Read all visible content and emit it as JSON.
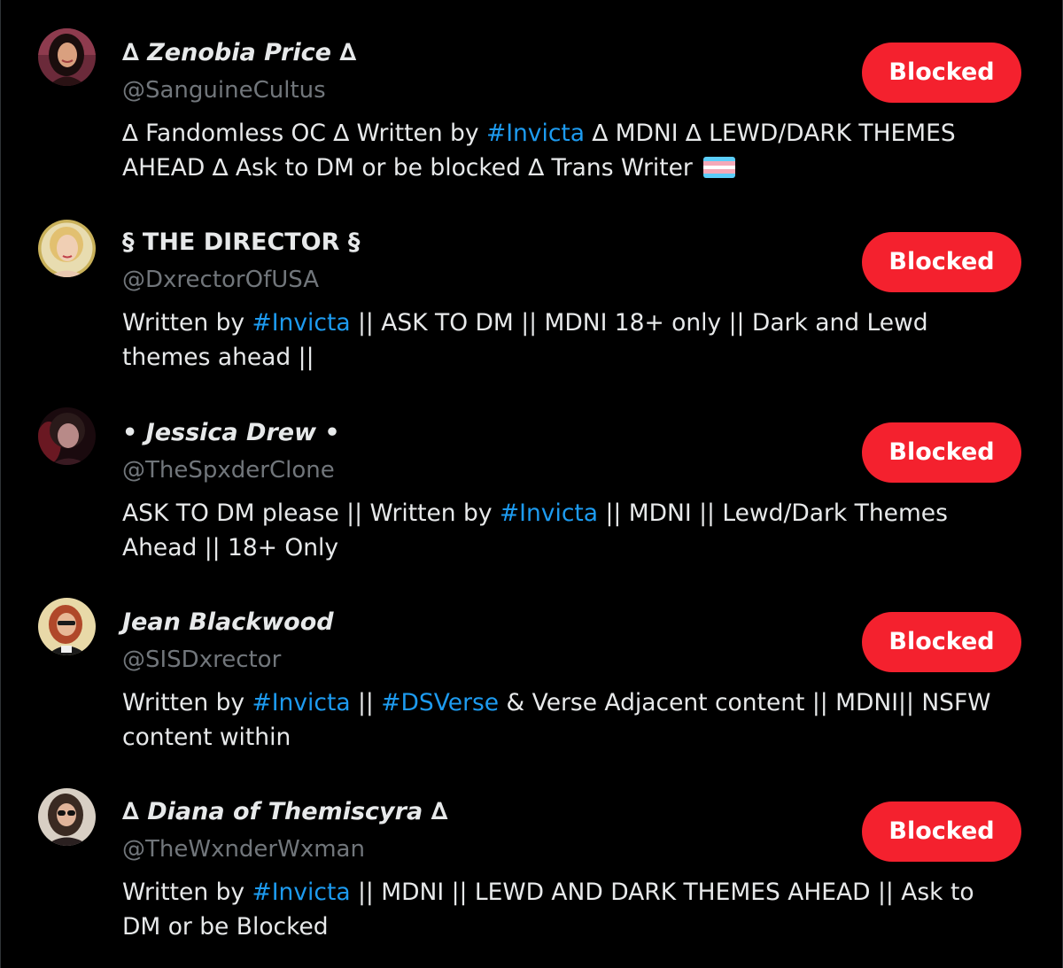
{
  "accounts": [
    {
      "display_name": "∆ Zenobia Price ∆",
      "handle": "@SanguineCultus",
      "bio": [
        {
          "text": "∆ Fandomless OC ∆ Written by "
        },
        {
          "text": "#Invicta",
          "hashtag": true
        },
        {
          "text": " ∆ MDNI ∆ LEWD/DARK THEMES AHEAD ∆ Ask to DM or be blocked ∆ Trans Writer"
        },
        {
          "emoji": "transgender-flag"
        }
      ],
      "button_label": "Blocked",
      "avatar_icon": "avatar-dark-haired-woman"
    },
    {
      "display_name": "§ THE DIRECTOR §",
      "handle": "@DxrectorOfUSA",
      "bio": [
        {
          "text": "Written by "
        },
        {
          "text": "#Invicta",
          "hashtag": true
        },
        {
          "text": " || ASK TO DM || MDNI 18+ only || Dark and Lewd themes ahead ||"
        }
      ],
      "button_label": "Blocked",
      "avatar_icon": "avatar-blonde-woman"
    },
    {
      "display_name": "• Jessica Drew •",
      "handle": "@TheSpxderClone",
      "bio": [
        {
          "text": "ASK TO DM please || Written by "
        },
        {
          "text": "#Invicta",
          "hashtag": true
        },
        {
          "text": " || MDNI || Lewd/Dark Themes Ahead || 18+ Only"
        }
      ],
      "button_label": "Blocked",
      "avatar_icon": "avatar-dark-red-portrait"
    },
    {
      "display_name": "Jean Blackwood",
      "handle": "@SISDxrector",
      "bio": [
        {
          "text": "Written by "
        },
        {
          "text": "#Invicta",
          "hashtag": true
        },
        {
          "text": " || "
        },
        {
          "text": "#DSVerse",
          "hashtag": true
        },
        {
          "text": " & Verse Adjacent content || MDNI|| NSFW content within"
        }
      ],
      "button_label": "Blocked",
      "avatar_icon": "avatar-red-haired-woman"
    },
    {
      "display_name": "∆ Diana of Themiscyra ∆",
      "handle": "@TheWxnderWxman",
      "bio": [
        {
          "text": "Written by "
        },
        {
          "text": "#Invicta",
          "hashtag": true
        },
        {
          "text": " || MDNI || LEWD AND DARK THEMES AHEAD || Ask to DM or be Blocked"
        }
      ],
      "button_label": "Blocked",
      "avatar_icon": "avatar-woman-with-sunglasses"
    }
  ],
  "colors": {
    "background": "#000000",
    "text_primary": "#e7e9ea",
    "text_secondary": "#71767b",
    "hashtag": "#1d9bf0",
    "blocked_button": "#f4212e",
    "blocked_button_text": "#ffffff"
  }
}
